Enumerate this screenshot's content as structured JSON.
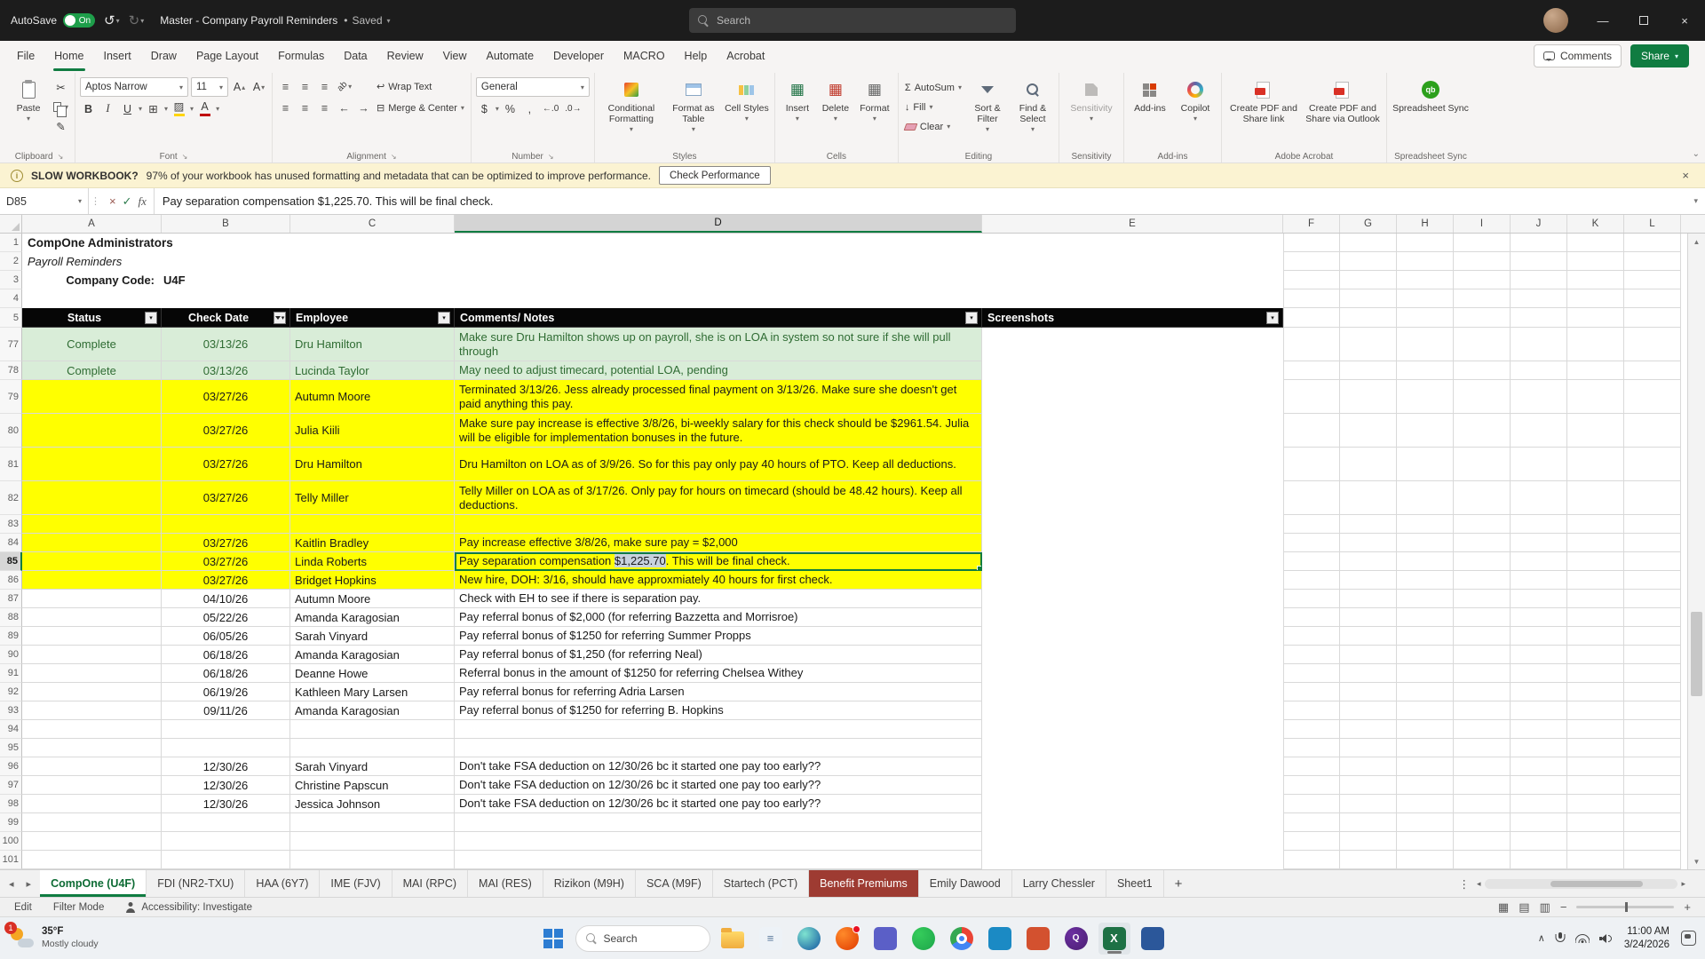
{
  "colors": {
    "excel_green": "#107C41",
    "yellow_fill": "#FFFF00",
    "green_fill": "#D9EDD8",
    "green_text": "#2F6C33",
    "benefit_tab_red": "#9E3B32",
    "text_highlight": "#C8D2DE"
  },
  "title_bar": {
    "autosave": "AutoSave",
    "autosave_state": "On",
    "title": "Master - Company Payroll Reminders",
    "saved": "Saved",
    "search": "Search"
  },
  "menu": {
    "tabs": [
      "File",
      "Home",
      "Insert",
      "Draw",
      "Page Layout",
      "Formulas",
      "Data",
      "Review",
      "View",
      "Automate",
      "Developer",
      "MACRO",
      "Help",
      "Acrobat"
    ],
    "active": "Home",
    "comments": "Comments",
    "share": "Share"
  },
  "ribbon": {
    "clipboard": {
      "paste": "Paste",
      "label": "Clipboard"
    },
    "font": {
      "name": "Aptos Narrow",
      "size": "11",
      "label": "Font"
    },
    "alignment": {
      "wrap": "Wrap Text",
      "merge": "Merge & Center",
      "label": "Alignment"
    },
    "number": {
      "format": "General",
      "label": "Number"
    },
    "styles": {
      "b1": "Conditional Formatting",
      "b2": "Format as Table",
      "b3": "Cell Styles",
      "label": "Styles"
    },
    "cells": {
      "b1": "Insert",
      "b2": "Delete",
      "b3": "Format",
      "label": "Cells"
    },
    "editing": {
      "autosum": "AutoSum",
      "fill": "Fill",
      "clear": "Clear",
      "sort": "Sort & Filter",
      "find": "Find & Select",
      "label": "Editing"
    },
    "sensitivity": {
      "b1": "Sensitivity",
      "label": "Sensitivity"
    },
    "addins": {
      "b1": "Add-ins",
      "copilot": "Copilot",
      "label": "Add-ins"
    },
    "acrobat": {
      "b1": "Create PDF and Share link",
      "b2": "Create PDF and Share via Outlook",
      "label": "Adobe Acrobat"
    },
    "sync": {
      "b1": "Spreadsheet Sync",
      "label": "Spreadsheet Sync"
    }
  },
  "warning": {
    "tag": "SLOW WORKBOOK?",
    "text": "97% of your workbook has unused formatting and metadata that can be optimized to improve performance.",
    "action": "Check Performance"
  },
  "formula_bar": {
    "name_box": "D85",
    "fx": "fx",
    "content": "Pay separation compensation $1,225.70. This will be final check."
  },
  "grid": {
    "columns": [
      "A",
      "B",
      "C",
      "D",
      "E",
      "F",
      "G",
      "H",
      "I",
      "J",
      "K",
      "L"
    ],
    "selected_column": "D",
    "selected_row": 85,
    "selected_cell": {
      "ref": "D85",
      "pre": "Pay separation compensation ",
      "highlight": "$1,225.70",
      "post": ". This will be final check."
    },
    "header_cells": [
      {
        "label": "Status",
        "align": "center"
      },
      {
        "label": "Check Date",
        "align": "center",
        "filtered": true
      },
      {
        "label": "Employee",
        "align": "left"
      },
      {
        "label": "Comments/ Notes",
        "align": "left"
      },
      {
        "label": "Screenshots",
        "align": "left"
      }
    ],
    "rows": [
      {
        "n": 1,
        "kind": "title",
        "text": "CompOne Administrators"
      },
      {
        "n": 2,
        "kind": "subtitle",
        "text": "Payroll Reminders"
      },
      {
        "n": 3,
        "kind": "code",
        "label": "Company Code:",
        "value": "U4F"
      },
      {
        "n": 4,
        "kind": "blank"
      },
      {
        "n": 5,
        "kind": "header"
      },
      {
        "n": 77,
        "kind": "data",
        "h": 2,
        "fill": "green",
        "status": "Complete",
        "date": "03/13/26",
        "employee": "Dru Hamilton",
        "comment": "Make sure Dru Hamilton shows up on payroll, she is on LOA in system so not sure if she will pull through"
      },
      {
        "n": 78,
        "kind": "data",
        "fill": "green",
        "status": "Complete",
        "date": "03/13/26",
        "employee": "Lucinda Taylor",
        "comment": "May need to adjust timecard, potential LOA, pending"
      },
      {
        "n": 79,
        "kind": "data",
        "h": 2,
        "fill": "yellow",
        "date": "03/27/26",
        "employee": "Autumn Moore",
        "comment": "Terminated 3/13/26. Jess already processed final payment on 3/13/26. Make sure she doesn't get paid anything this pay."
      },
      {
        "n": 80,
        "kind": "data",
        "h": 2,
        "fill": "yellow",
        "date": "03/27/26",
        "employee": "Julia Kiili",
        "comment": "Make sure pay increase is effective 3/8/26, bi-weekly salary for this check should be $2961.54. Julia will be eligible for implementation bonuses in the future."
      },
      {
        "n": 81,
        "kind": "data",
        "h": 2,
        "fill": "yellow",
        "date": "03/27/26",
        "employee": "Dru Hamilton",
        "comment": "Dru Hamilton on LOA as of 3/9/26. So for this pay only pay 40 hours of PTO. Keep all deductions."
      },
      {
        "n": 82,
        "kind": "data",
        "h": 2,
        "fill": "yellow",
        "date": "03/27/26",
        "employee": "Telly Miller",
        "comment": "Telly Miller on LOA as of 3/17/26. Only pay for hours on timecard (should be 48.42 hours). Keep all deductions."
      },
      {
        "n": 83,
        "kind": "data",
        "fill": "yellow"
      },
      {
        "n": 84,
        "kind": "data",
        "fill": "yellow",
        "date": "03/27/26",
        "employee": "Kaitlin Bradley",
        "comment": "Pay increase effective 3/8/26, make sure pay = $2,000"
      },
      {
        "n": 85,
        "kind": "data",
        "fill": "yellow",
        "date": "03/27/26",
        "employee": "Linda Roberts",
        "selected": true
      },
      {
        "n": 86,
        "kind": "data",
        "fill": "yellow",
        "date": "03/27/26",
        "employee": "Bridget Hopkins",
        "comment": "New hire, DOH: 3/16, should have approxmiately 40 hours for first check."
      },
      {
        "n": 87,
        "kind": "data",
        "date": "04/10/26",
        "employee": "Autumn Moore",
        "comment": "Check with EH to see if there is separation pay."
      },
      {
        "n": 88,
        "kind": "data",
        "date": "05/22/26",
        "employee": "Amanda Karagosian",
        "comment": "Pay referral bonus of $2,000 (for referring Bazzetta and Morrisroe)"
      },
      {
        "n": 89,
        "kind": "data",
        "date": "06/05/26",
        "employee": "Sarah Vinyard",
        "comment": "Pay referral bonus of $1250 for referring Summer Propps"
      },
      {
        "n": 90,
        "kind": "data",
        "date": "06/18/26",
        "employee": "Amanda Karagosian",
        "comment": "Pay referral bonus of $1,250 (for referring Neal)"
      },
      {
        "n": 91,
        "kind": "data",
        "date": "06/18/26",
        "employee": "Deanne Howe",
        "comment": "Referral bonus in the amount of $1250 for referring Chelsea Withey"
      },
      {
        "n": 92,
        "kind": "data",
        "date": "06/19/26",
        "employee": "Kathleen Mary Larsen",
        "comment": "Pay referral bonus for referring Adria Larsen"
      },
      {
        "n": 93,
        "kind": "data",
        "date": "09/11/26",
        "employee": "Amanda Karagosian",
        "comment": "Pay referral bonus of $1250 for referring B. Hopkins"
      },
      {
        "n": 94,
        "kind": "data"
      },
      {
        "n": 95,
        "kind": "data"
      },
      {
        "n": 96,
        "kind": "data",
        "date": "12/30/26",
        "employee": "Sarah Vinyard",
        "comment": "Don't take FSA deduction on 12/30/26 bc it started one pay too early??"
      },
      {
        "n": 97,
        "kind": "data",
        "date": "12/30/26",
        "employee": "Christine Papscun",
        "comment": "Don't take FSA deduction on 12/30/26 bc it started one pay too early??"
      },
      {
        "n": 98,
        "kind": "data",
        "date": "12/30/26",
        "employee": "Jessica Johnson",
        "comment": "Don't take FSA deduction on 12/30/26 bc it started one pay too early??"
      },
      {
        "n": 99,
        "kind": "data"
      },
      {
        "n": 100,
        "kind": "data"
      },
      {
        "n": 101,
        "kind": "data"
      }
    ]
  },
  "sheet_tabs": {
    "tabs": [
      {
        "label": "CompOne (U4F)",
        "active": true
      },
      {
        "label": "FDI (NR2-TXU)"
      },
      {
        "label": "HAA (6Y7)"
      },
      {
        "label": "IME (FJV)"
      },
      {
        "label": "MAI (RPC)"
      },
      {
        "label": "MAI (RES)"
      },
      {
        "label": "Rizikon (M9H)"
      },
      {
        "label": "SCA (M9F)"
      },
      {
        "label": "Startech (PCT)"
      },
      {
        "label": "Benefit Premiums",
        "red": true
      },
      {
        "label": "Emily Dawood"
      },
      {
        "label": "Larry Chessler"
      },
      {
        "label": "Sheet1"
      }
    ],
    "new_sheet": "+"
  },
  "status_bar": {
    "mode": "Edit",
    "filter": "Filter Mode",
    "accessibility": "Accessibility: Investigate"
  },
  "taskbar": {
    "weather": {
      "temp": "35°F",
      "desc": "Mostly cloudy",
      "badge": "1"
    },
    "search": "Search",
    "apps": [
      {
        "name": "file-explorer",
        "shape": "folder"
      },
      {
        "name": "notepad",
        "shape": "square",
        "color": "#EDF2F7",
        "fg": "#5B7A9D",
        "glyph": "≡"
      },
      {
        "name": "edge",
        "shape": "circle",
        "color": "#7EE3D0",
        "color2": "#1256A0"
      },
      {
        "name": "firefox",
        "shape": "circle",
        "color": "#FF8A2A",
        "color2": "#E03A00",
        "badge": true
      },
      {
        "name": "teams",
        "shape": "square",
        "color": "#5B5FC7"
      },
      {
        "name": "whatsapp",
        "shape": "circle",
        "color": "#35CC5B",
        "color2": "#1DA64A"
      },
      {
        "name": "chrome",
        "shape": "chrome"
      },
      {
        "name": "outlook",
        "shape": "square",
        "color": "#1B8AC4"
      },
      {
        "name": "powerpoint",
        "shape": "square",
        "color": "#D3512F"
      },
      {
        "name": "quickbooks",
        "shape": "circle",
        "color": "#6B2FA0",
        "color2": "#4B1F73",
        "glyph": "Q"
      },
      {
        "name": "excel",
        "shape": "square",
        "color": "#1E7145",
        "glyph": "X",
        "active": true
      },
      {
        "name": "word",
        "shape": "square",
        "color": "#2B579A"
      }
    ],
    "clock": {
      "time": "11:00 AM",
      "date": "3/24/2026"
    }
  }
}
